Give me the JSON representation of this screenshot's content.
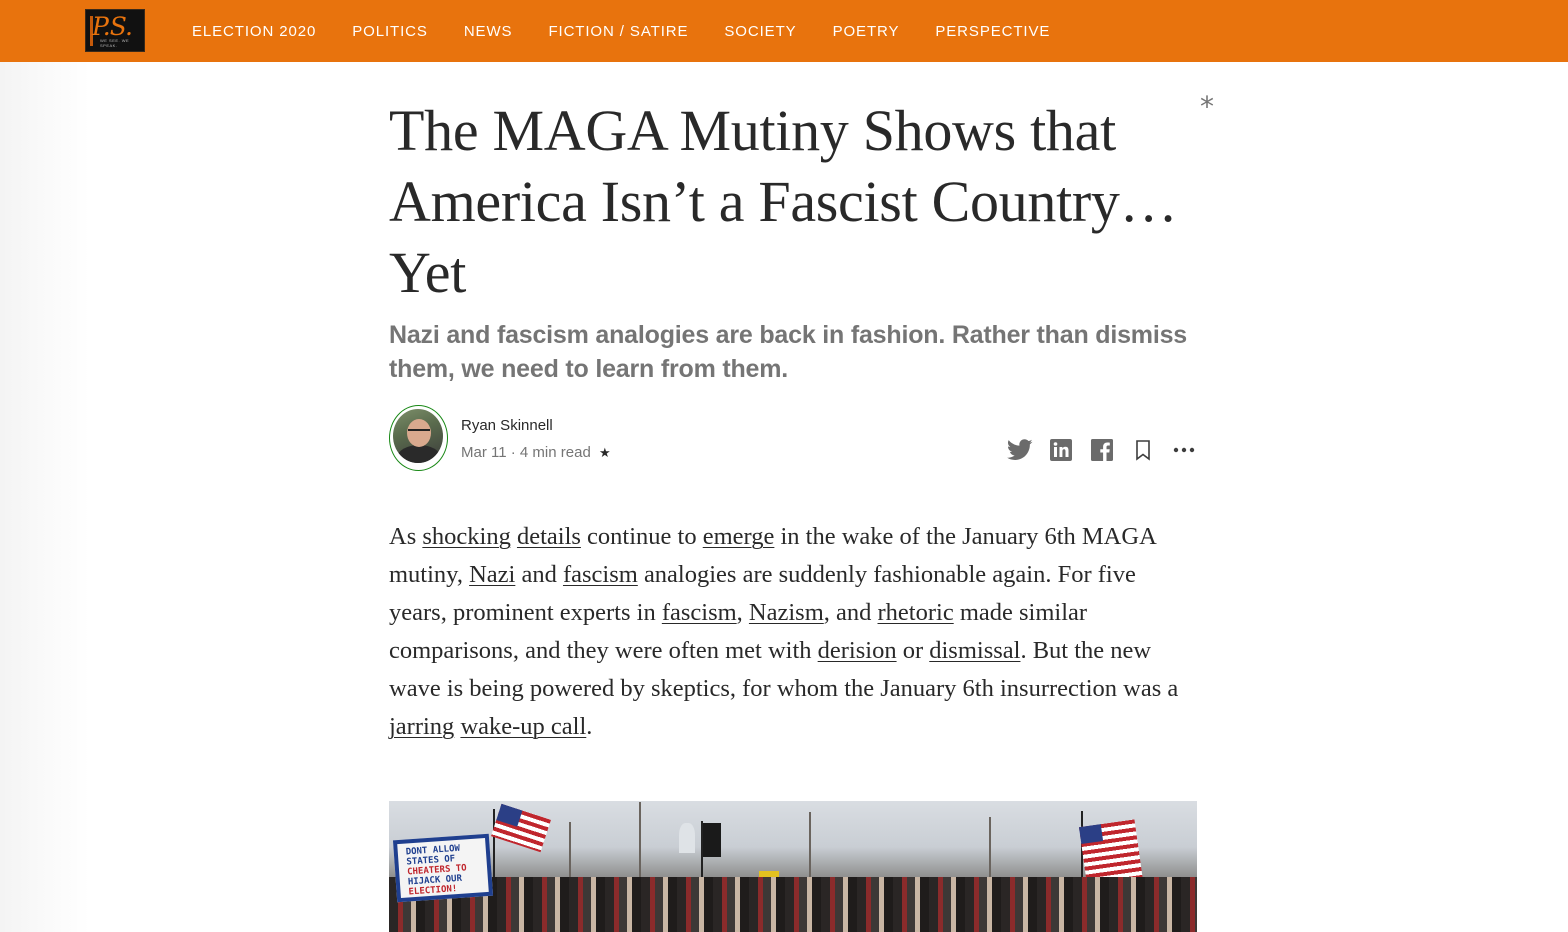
{
  "nav": {
    "logo_text": "P.S.",
    "logo_tagline": "WE SEE. WE SPEAK.",
    "items": [
      {
        "label": "ELECTION 2020"
      },
      {
        "label": "POLITICS"
      },
      {
        "label": "NEWS"
      },
      {
        "label": "FICTION / SATIRE"
      },
      {
        "label": "SOCIETY"
      },
      {
        "label": "POETRY"
      },
      {
        "label": "PERSPECTIVE"
      }
    ]
  },
  "article": {
    "title": "The MAGA Mutiny Shows that America Isn’t a Fascist Country… Yet",
    "title_mark": "*",
    "subtitle": "Nazi and fascism analogies are back in fashion. Rather than dismiss them, we need to learn from them.",
    "author": {
      "name": "Ryan Skinnell",
      "date": "Mar 11",
      "separator": "·",
      "read_time": "4 min read",
      "member_star": "★"
    },
    "actions": {
      "icons": [
        "twitter-icon",
        "linkedin-icon",
        "facebook-icon",
        "bookmark-icon",
        "more-icon"
      ]
    },
    "paragraph": {
      "t1": "As ",
      "l1": "shocking",
      "t2": " ",
      "l2": "details",
      "t3": " continue to ",
      "l3": "emerge",
      "t4": " in the wake of the January 6th MAGA mutiny, ",
      "l4": "Nazi",
      "t5": " and ",
      "l5": "fascism",
      "t6": " analogies are suddenly fashionable again. For five years, prominent experts in ",
      "l6": "fascism",
      "t7": ", ",
      "l7": "Nazism",
      "t8": ", and ",
      "l8": "rhetoric",
      "t9": " made similar comparisons, and they were often met with ",
      "l9": "derision",
      "t10": " or ",
      "l10": "dismissal",
      "t11": ". But the new wave is being powered by skeptics, for whom the January 6th insurrection was a ",
      "l11": "jarring",
      "t12": " ",
      "l12": "wake-up call",
      "t13": "."
    },
    "hero_sign": {
      "line1": "DONT ALLOW",
      "line2": "STATES OF",
      "line3": "CHEATERS TO",
      "line4": "HIJACK OUR",
      "line5": "ELECTION!"
    }
  },
  "colors": {
    "topbar": "#e8730d",
    "text": "#292929",
    "muted": "#757575",
    "avatar_ring": "#1a8917"
  }
}
